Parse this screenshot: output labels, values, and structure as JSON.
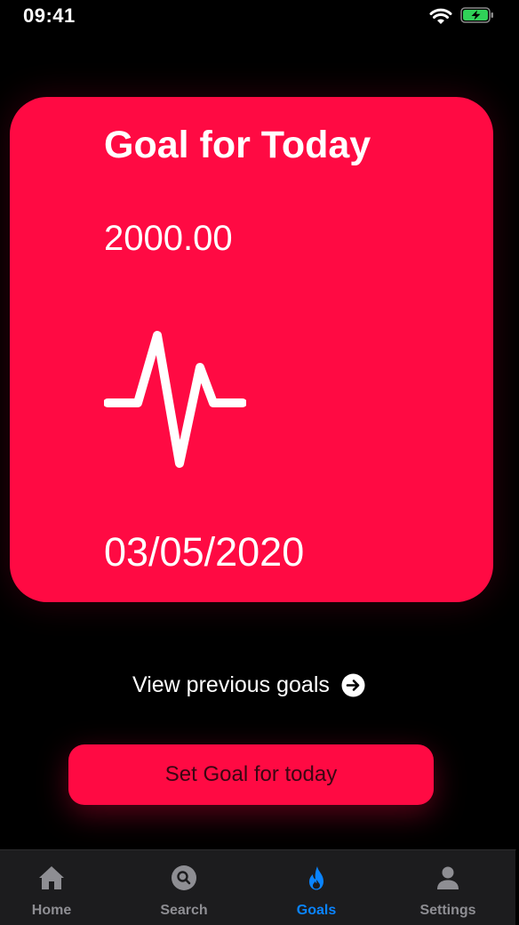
{
  "status_bar": {
    "time": "09:41"
  },
  "goal_card": {
    "title": "Goal for Today",
    "amount": "2000.00",
    "date": "03/05/2020",
    "icon": "waveform-path-ecg-icon",
    "color": "#ff0a43"
  },
  "previous_goals": {
    "label": "View previous goals",
    "icon": "arrow-right-circle-icon"
  },
  "set_goal_button": {
    "label": "Set Goal for today"
  },
  "tab_bar": {
    "active_color": "#0a84ff",
    "inactive_color": "#8e8e93",
    "items": [
      {
        "label": "Home",
        "icon": "house-icon",
        "active": false
      },
      {
        "label": "Search",
        "icon": "search-icon",
        "active": false
      },
      {
        "label": "Goals",
        "icon": "flame-icon",
        "active": true
      },
      {
        "label": "Settings",
        "icon": "person-icon",
        "active": false
      }
    ]
  }
}
